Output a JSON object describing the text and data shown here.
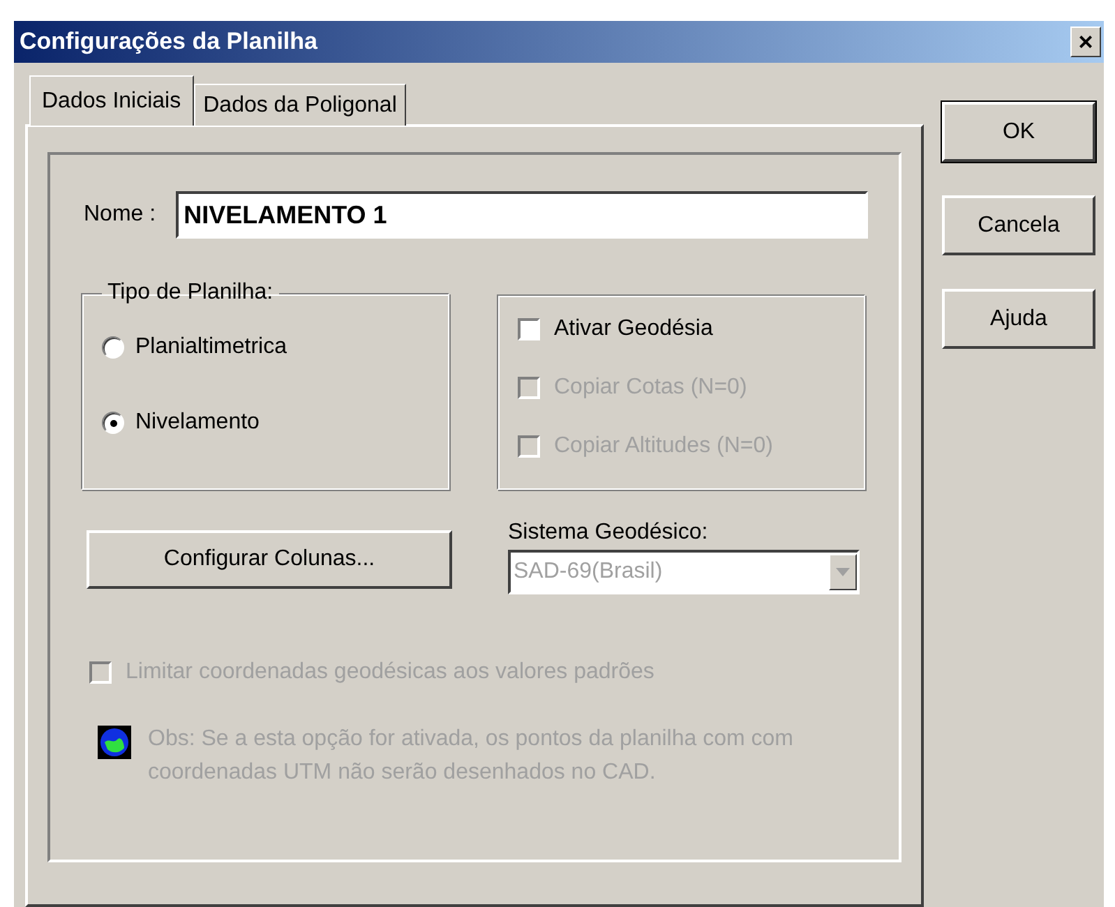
{
  "window": {
    "title": "Configurações da Planilha",
    "close": "×"
  },
  "tabs": [
    {
      "label": "Dados Iniciais",
      "selected": true
    },
    {
      "label": "Dados da Poligonal",
      "selected": false
    }
  ],
  "name_field": {
    "label": "Nome :",
    "value": "NIVELAMENTO 1"
  },
  "sheet_type": {
    "legend": "Tipo de Planilha:",
    "options": [
      {
        "label": "Planialtimetrica",
        "selected": false
      },
      {
        "label": "Nivelamento",
        "selected": true
      }
    ]
  },
  "geodesy": {
    "options": [
      {
        "label": "Ativar Geodésia",
        "checked": false,
        "disabled": false
      },
      {
        "label": "Copiar Cotas (N=0)",
        "checked": false,
        "disabled": true
      },
      {
        "label": "Copiar Altitudes (N=0)",
        "checked": false,
        "disabled": true
      }
    ]
  },
  "configure_button": "Configurar Colunas...",
  "geodetic_system": {
    "label": "Sistema Geodésico:",
    "value": "SAD-69(Brasil)",
    "disabled": true
  },
  "limit_option": {
    "label": "Limitar coordenadas geodésicas aos valores padrões",
    "checked": false,
    "disabled": true
  },
  "note": "Obs: Se a esta opção for ativada, os pontos da planilha com com coordenadas UTM não serão desenhados no CAD.",
  "buttons": [
    "OK",
    "Cancela",
    "Ajuda"
  ]
}
